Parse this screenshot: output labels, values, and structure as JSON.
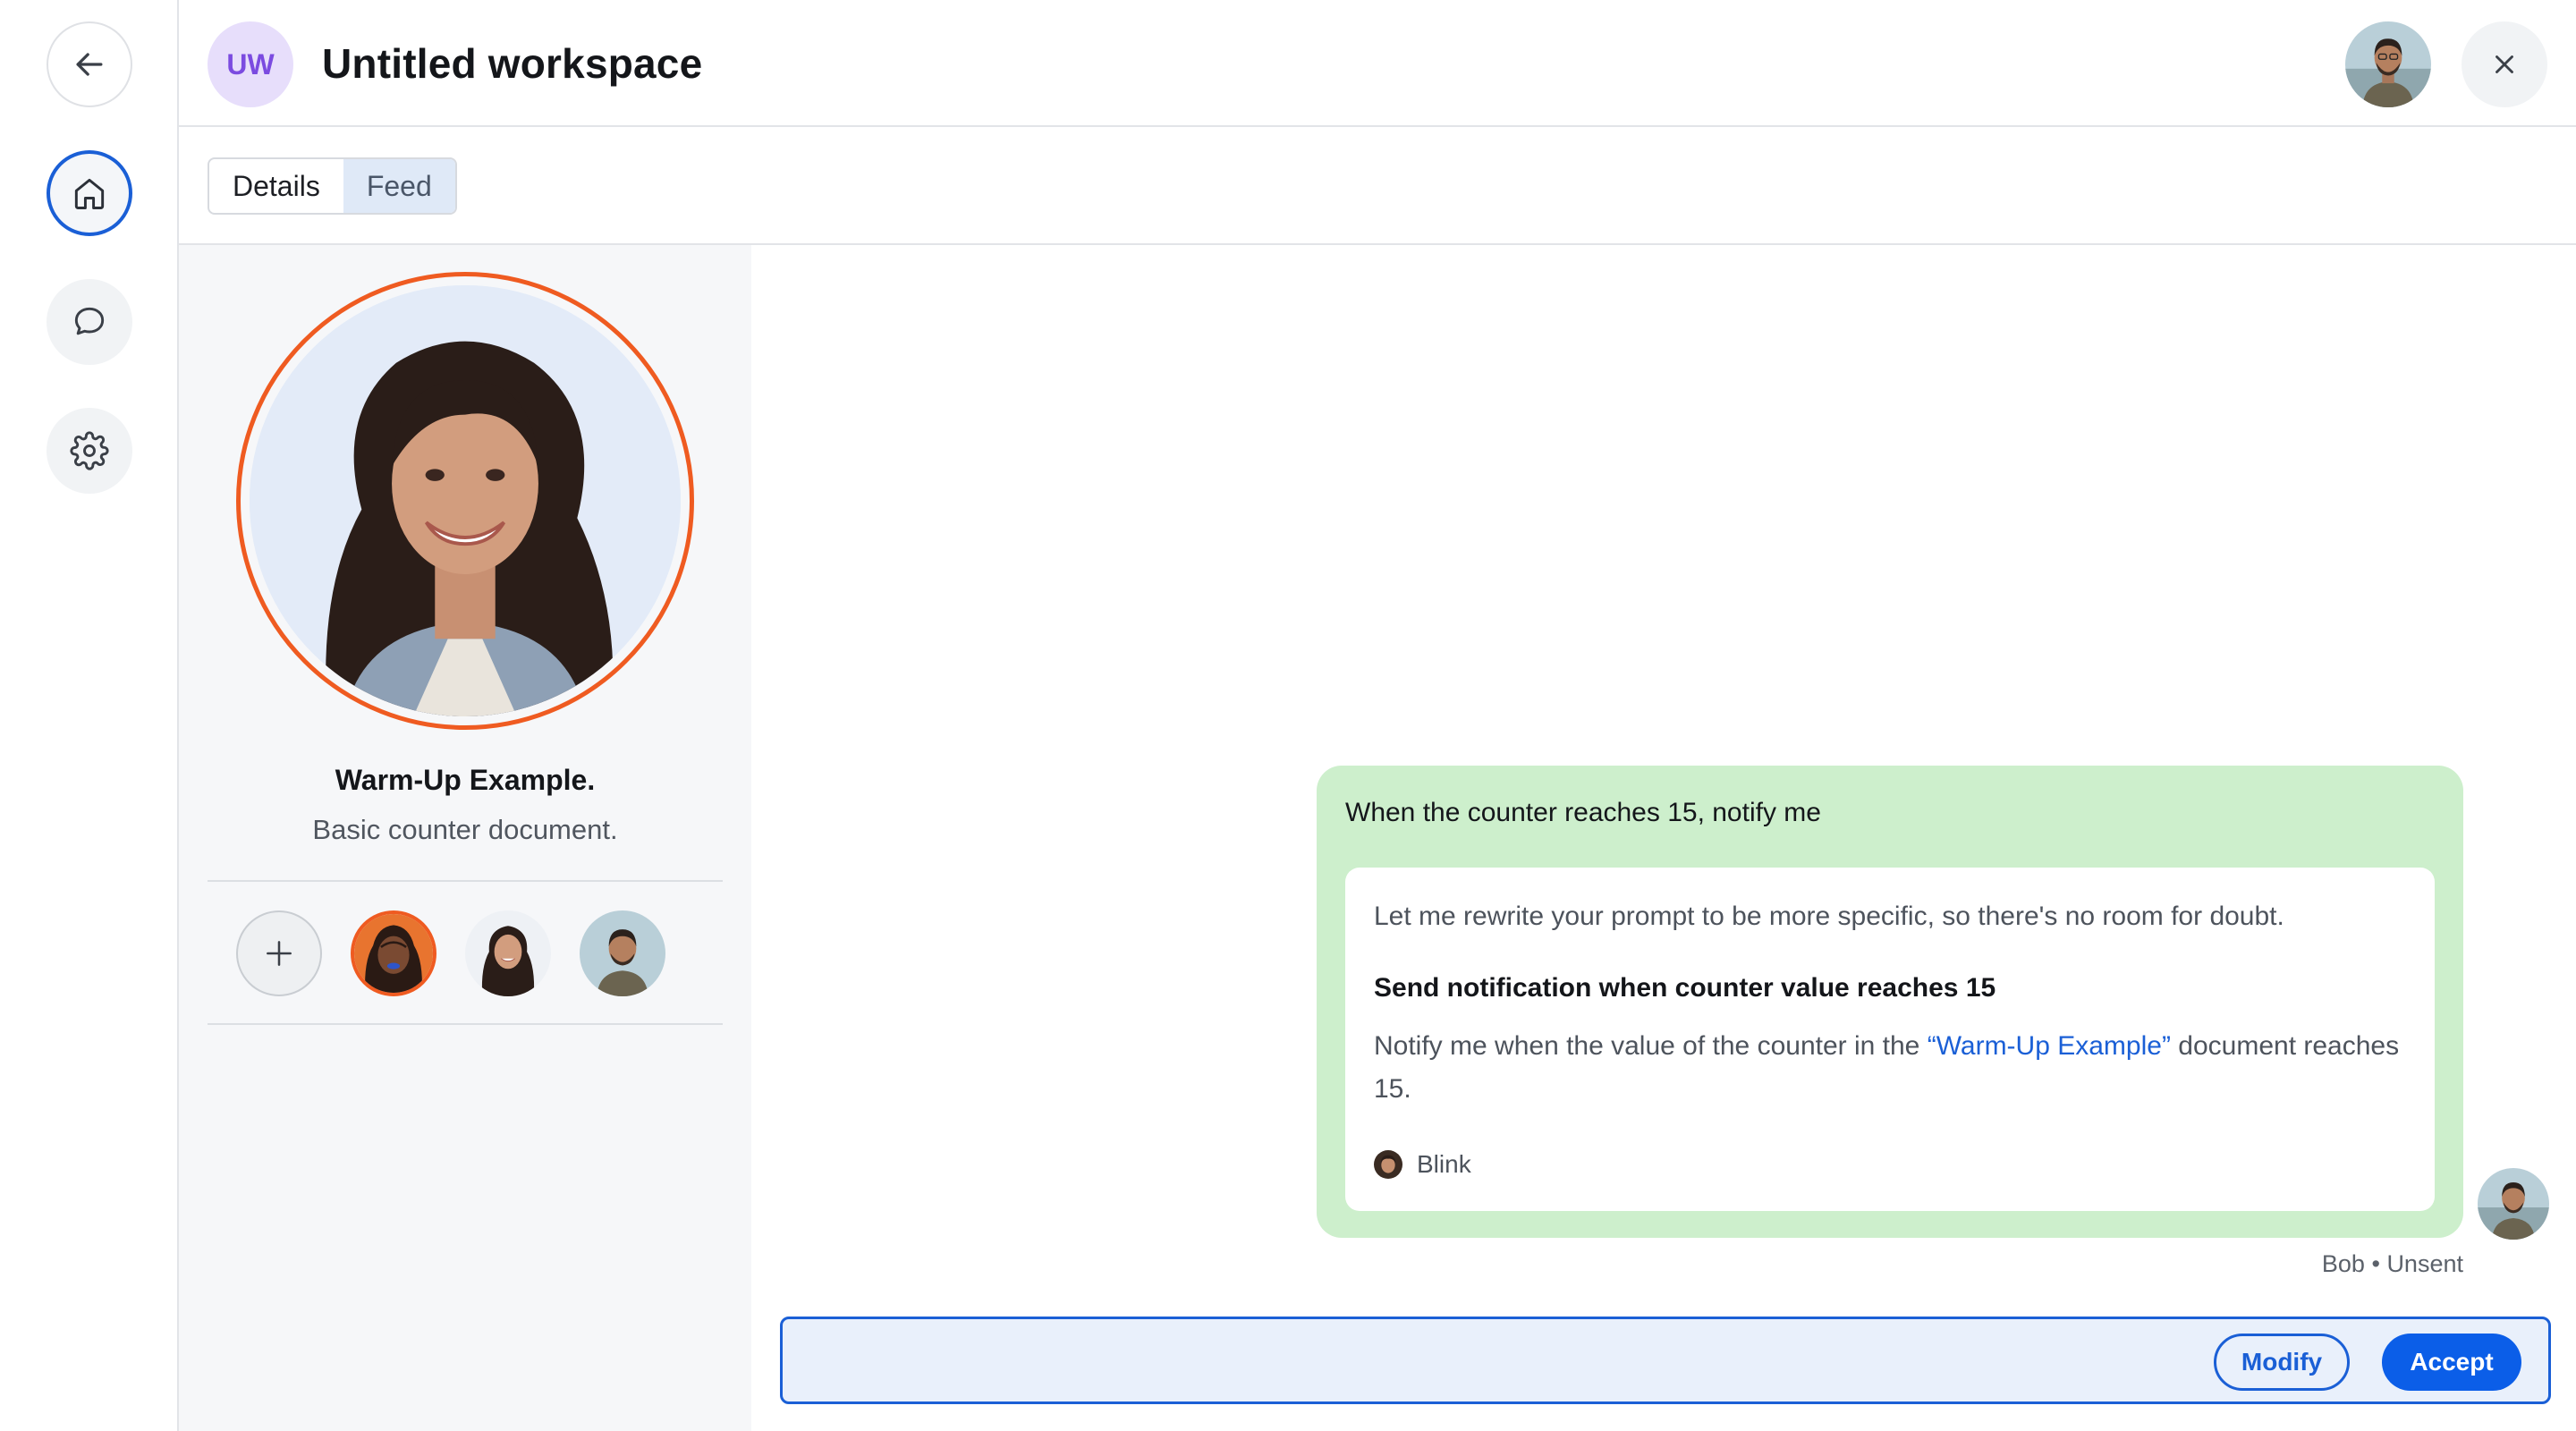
{
  "header": {
    "badge": "UW",
    "title": "Untitled workspace"
  },
  "tabs": [
    {
      "label": "Details",
      "active": false
    },
    {
      "label": "Feed",
      "active": true
    }
  ],
  "document": {
    "title": "Warm-Up Example.",
    "subtitle": "Basic counter document."
  },
  "message": {
    "prompt": "When the counter reaches 15, notify me",
    "intro": "Let me rewrite your prompt to be more specific, so there's no room for doubt.",
    "heading": "Send notification when counter value reaches 15",
    "body_before": "Notify me when the value of the counter in the ",
    "body_link": "“Warm-Up Example”",
    "body_after": " document reaches 15.",
    "author": "Blink",
    "sender": "Bob",
    "separator": "•",
    "status": "Unsent"
  },
  "actions": {
    "modify_label": "Modify",
    "accept_label": "Accept"
  },
  "icons": {
    "back": "arrow-left-icon",
    "home": "home-icon",
    "chat": "chat-bubble-icon",
    "settings": "gear-icon",
    "close": "close-icon",
    "add": "plus-icon"
  },
  "colors": {
    "accent": "#1a5fd6",
    "accept_button": "#0b5ee8",
    "bubble": "#cdefcc",
    "avatar_ring": "#ef5b21",
    "badge_bg": "#e7defb",
    "badge_text": "#7b4be0"
  }
}
